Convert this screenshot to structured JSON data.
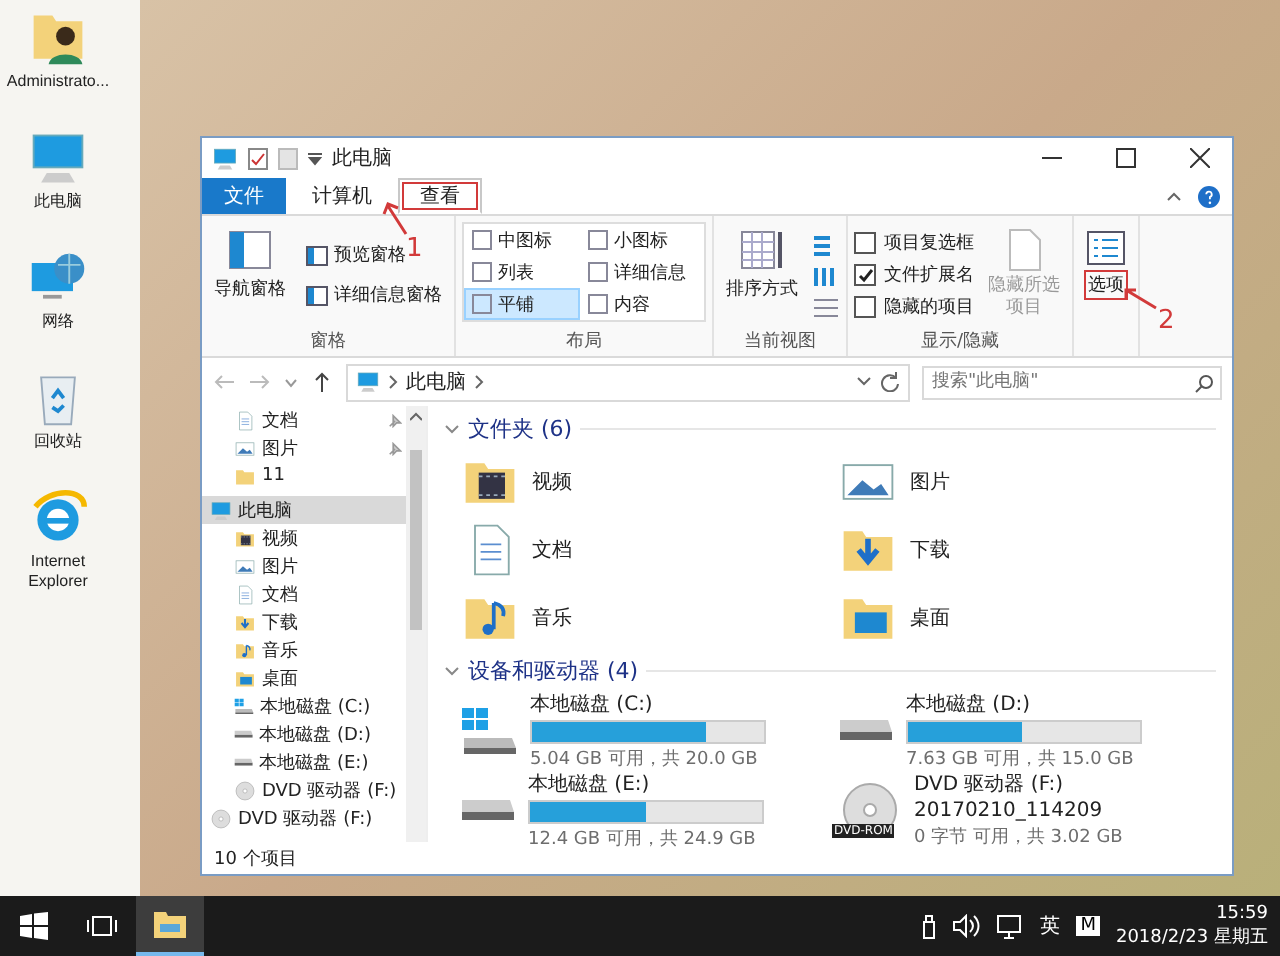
{
  "desktop_icons": [
    {
      "label": "Administrato...",
      "kind": "user"
    },
    {
      "label": "此电脑",
      "kind": "pc"
    },
    {
      "label": "网络",
      "kind": "network"
    },
    {
      "label": "回收站",
      "kind": "recycle"
    },
    {
      "label": "Internet Explorer",
      "kind": "ie"
    }
  ],
  "window": {
    "title": "此电脑"
  },
  "ribbon": {
    "tabs": [
      {
        "label": "文件",
        "kind": "file",
        "selected": false,
        "highlighted": false
      },
      {
        "label": "计算机",
        "kind": "tab",
        "selected": false,
        "highlighted": false
      },
      {
        "label": "查看",
        "kind": "tab",
        "selected": true,
        "highlighted": true
      }
    ],
    "groups": [
      {
        "kind": "panes",
        "label": "窗格",
        "big": "导航窗格",
        "items": [
          "预览窗格",
          "详细信息窗格"
        ]
      },
      {
        "kind": "layout",
        "label": "布局",
        "items": [
          {
            "label": "中图标",
            "selected": false
          },
          {
            "label": "小图标",
            "selected": false
          },
          {
            "label": "列表",
            "selected": false
          },
          {
            "label": "详细信息",
            "selected": false
          },
          {
            "label": "平铺",
            "selected": true
          },
          {
            "label": "内容",
            "selected": false
          }
        ]
      },
      {
        "kind": "view",
        "label": "当前视图",
        "big": "排序方式"
      },
      {
        "kind": "show",
        "label": "显示/隐藏",
        "checks": [
          {
            "label": "项目复选框",
            "checked": false
          },
          {
            "label": "文件扩展名",
            "checked": true
          },
          {
            "label": "隐藏的项目",
            "checked": false
          }
        ],
        "button": {
          "label": "隐藏所选项目",
          "disabled": true
        }
      },
      {
        "kind": "options",
        "big": "选项",
        "highlighted": true
      }
    ]
  },
  "annotations": [
    "1",
    "2"
  ],
  "address": {
    "path": "此电脑",
    "search_placeholder": "搜索\"此电脑\""
  },
  "nav": {
    "quick_access": [
      {
        "label": "文档",
        "kind": "doc",
        "pinned": true
      },
      {
        "label": "图片",
        "kind": "pic",
        "pinned": true
      },
      {
        "label": "11",
        "kind": "folder",
        "pinned": false
      }
    ],
    "tree": [
      {
        "label": "此电脑",
        "kind": "pc",
        "selected": true,
        "children": [
          {
            "label": "视频",
            "kind": "video",
            "selected": false
          },
          {
            "label": "图片",
            "kind": "pic",
            "selected": false
          },
          {
            "label": "文档",
            "kind": "doc",
            "selected": false
          },
          {
            "label": "下载",
            "kind": "download",
            "selected": false
          },
          {
            "label": "音乐",
            "kind": "music",
            "selected": false
          },
          {
            "label": "桌面",
            "kind": "desktop",
            "selected": false
          },
          {
            "label": "本地磁盘 (C:)",
            "kind": "system",
            "selected": false
          },
          {
            "label": "本地磁盘 (D:)",
            "kind": "disk",
            "selected": false
          },
          {
            "label": "本地磁盘 (E:)",
            "kind": "disk",
            "selected": false
          },
          {
            "label": "DVD 驱动器 (F:)",
            "kind": "dvd",
            "selected": false
          }
        ]
      },
      {
        "label": "DVD 驱动器 (F:)",
        "kind": "dvd",
        "selected": false
      }
    ]
  },
  "content": {
    "sections": [
      {
        "title": "文件夹 (6)",
        "kind": "folders",
        "expanded": true,
        "items": [
          {
            "label": "视频",
            "kind": "video"
          },
          {
            "label": "图片",
            "kind": "pic"
          },
          {
            "label": "文档",
            "kind": "doc"
          },
          {
            "label": "下载",
            "kind": "download"
          },
          {
            "label": "音乐",
            "kind": "music"
          },
          {
            "label": "桌面",
            "kind": "desktop"
          }
        ]
      },
      {
        "title": "设备和驱动器 (4)",
        "kind": "drives",
        "expanded": true,
        "items": [
          {
            "label": "本地磁盘 (C:)",
            "kind": "system",
            "level": 0.75,
            "reading": "5.04 GB 可用，共 20.0 GB"
          },
          {
            "label": "本地磁盘 (D:)",
            "kind": "disk",
            "level": 0.49,
            "reading": "7.63 GB 可用，共 15.0 GB"
          },
          {
            "label": "本地磁盘 (E:)",
            "kind": "disk",
            "level": 0.5,
            "reading": "12.4 GB 可用，共 24.9 GB"
          },
          {
            "label": "DVD 驱动器 (F:)",
            "kind": "dvd",
            "badge": "DVD-ROM",
            "volume": "20170210_114209",
            "reading": "0 字节 可用，共 3.02 GB"
          }
        ]
      }
    ]
  },
  "status_bar": "10 个项目",
  "taskbar": {
    "apps": [
      {
        "kind": "start",
        "active": false
      },
      {
        "kind": "taskview",
        "active": false
      },
      {
        "kind": "explorer",
        "active": true
      }
    ],
    "ime": "英",
    "ime_mode": "M",
    "time": "15:59",
    "date": "2018/2/23 星期五"
  }
}
